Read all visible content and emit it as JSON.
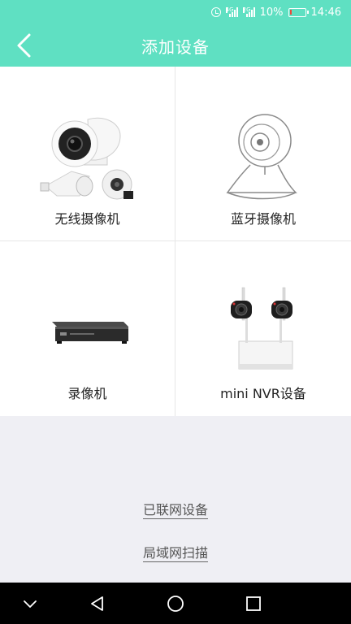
{
  "status_bar": {
    "network_1": "4G",
    "network_2": "2G",
    "battery_text": "10%",
    "battery_level": 0.1,
    "time": "14:46",
    "icons": [
      "alarm-icon",
      "signal-icon",
      "battery-icon"
    ]
  },
  "header": {
    "title": "添加设备",
    "back_icon": "chevron-left-icon"
  },
  "devices": [
    {
      "label": "无线摄像机",
      "icon": "wireless-camera-image"
    },
    {
      "label": "蓝牙摄像机",
      "icon": "bluetooth-camera-image"
    },
    {
      "label": "录像机",
      "icon": "video-recorder-image"
    },
    {
      "label": "mini NVR设备",
      "icon": "mini-nvr-image"
    }
  ],
  "links": {
    "networked_devices": "已联网设备",
    "lan_scan": "局域网扫描"
  },
  "system_nav": [
    "chevron-down-icon",
    "back-triangle-icon",
    "home-circle-icon",
    "recents-square-icon"
  ],
  "colors": {
    "accent": "#5fe0c2",
    "background": "#efeff4",
    "battery_low": "#e94b3c"
  }
}
